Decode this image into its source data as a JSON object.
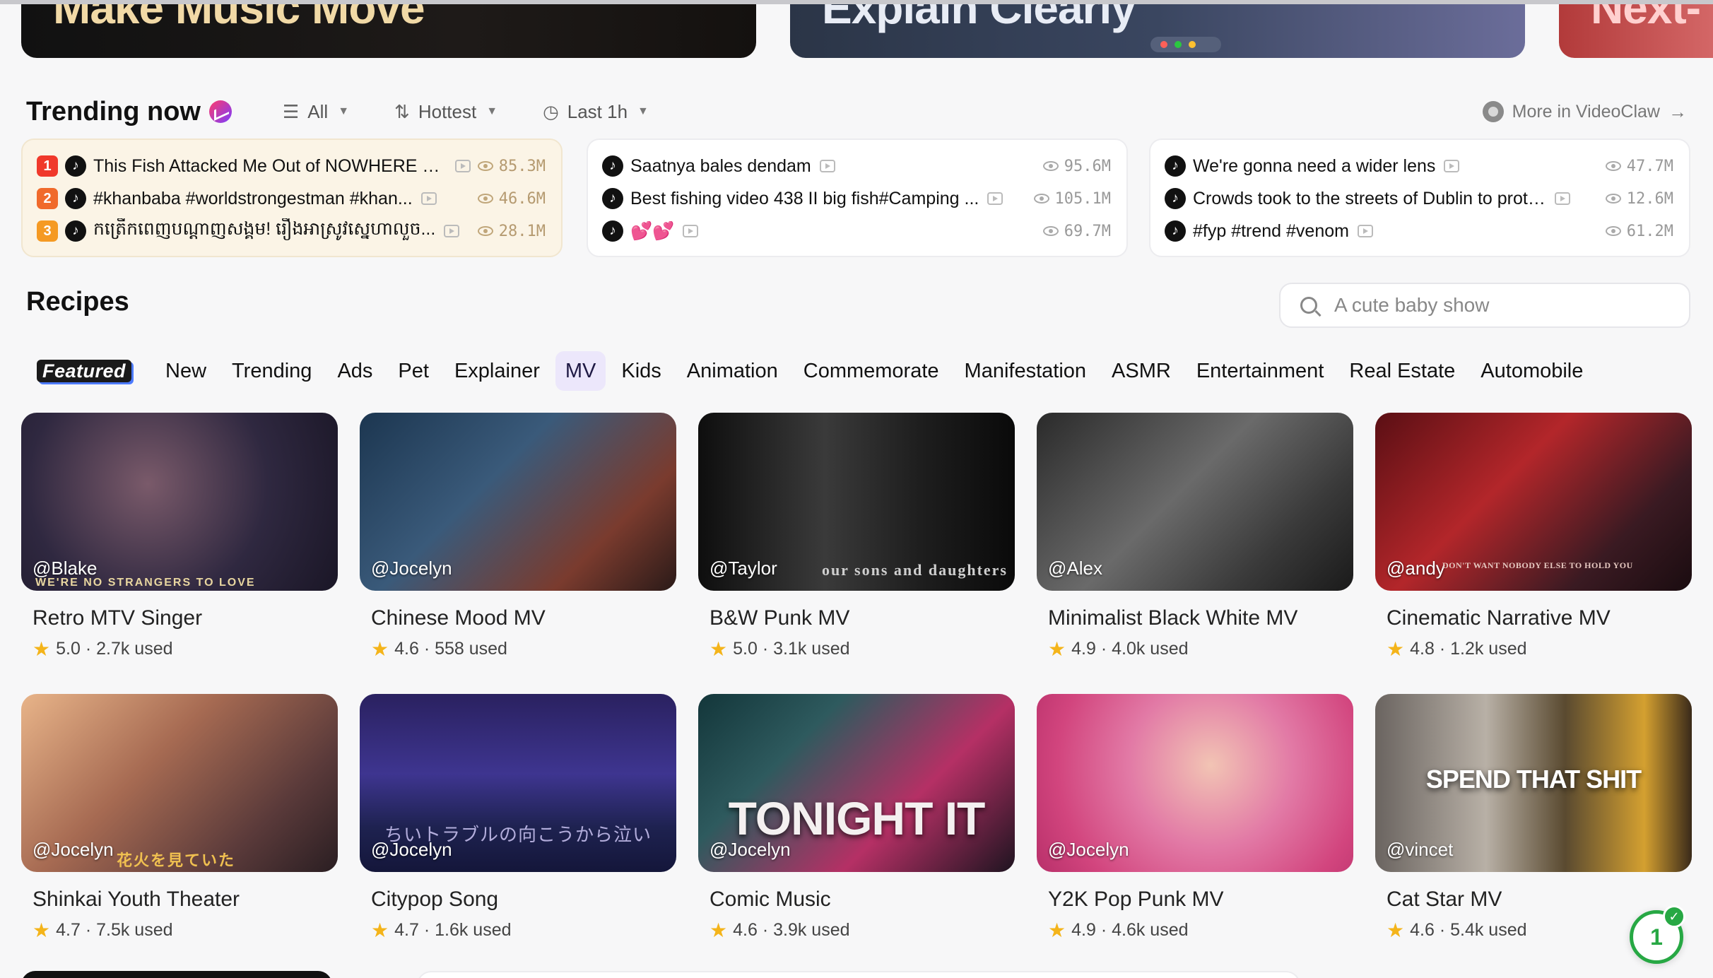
{
  "banners": [
    {
      "text": "Make Music Move"
    },
    {
      "text": "Explain Clearly"
    },
    {
      "text": "Next-"
    }
  ],
  "trending": {
    "title": "Trending now",
    "filters": [
      {
        "label": "All",
        "icon": "filter-icon"
      },
      {
        "label": "Hottest",
        "icon": "sort-icon"
      },
      {
        "label": "Last 1h",
        "icon": "clock-icon"
      }
    ],
    "more_link": "More in VideoClaw",
    "columns": [
      {
        "items": [
          {
            "rank": "1",
            "text": "This Fish Attacked Me Out of NOWHERE 😂...",
            "views": "85.3M"
          },
          {
            "rank": "2",
            "text": "#khanbaba #worldstrongestman #khan...",
            "views": "46.6M"
          },
          {
            "rank": "3",
            "text": "កត្រើកពេញបណ្ដាញសង្គម! រឿងអាស្រូវស្នេហាលួច...",
            "views": "28.1M"
          }
        ]
      },
      {
        "items": [
          {
            "text": "Saatnya bales dendam",
            "views": "95.6M"
          },
          {
            "text": "Best fishing video 438 II big fish#Camping ...",
            "views": "105.1M"
          },
          {
            "text": "💕💕",
            "views": "69.7M"
          }
        ]
      },
      {
        "items": [
          {
            "text": "We're gonna need a wider lens",
            "views": "47.7M"
          },
          {
            "text": "Crowds took to the streets of Dublin to protes...",
            "views": "12.6M"
          },
          {
            "text": "#fyp #trend #venom",
            "views": "61.2M"
          }
        ]
      }
    ]
  },
  "recipes": {
    "title": "Recipes",
    "search_placeholder": "A cute baby show",
    "tabs": [
      "Featured",
      "New",
      "Trending",
      "Ads",
      "Pet",
      "Explainer",
      "MV",
      "Kids",
      "Animation",
      "Commemorate",
      "Manifestation",
      "ASMR",
      "Entertainment",
      "Real Estate",
      "Automobile"
    ],
    "active_tab": "MV",
    "cards": [
      {
        "title": "Retro MTV Singer",
        "handle": "@Blake",
        "rating": "5.0",
        "used": "2.7k used",
        "overlay": "WE'RE NO STRANGERS TO LOVE"
      },
      {
        "title": "Chinese Mood MV",
        "handle": "@Jocelyn",
        "rating": "4.6",
        "used": "558 used",
        "overlay": ""
      },
      {
        "title": "B&W Punk MV",
        "handle": "@Taylor",
        "rating": "5.0",
        "used": "3.1k used",
        "overlay": "our sons and daughters"
      },
      {
        "title": "Minimalist Black White MV",
        "handle": "@Alex",
        "rating": "4.9",
        "used": "4.0k used",
        "overlay": ""
      },
      {
        "title": "Cinematic Narrative MV",
        "handle": "@andy",
        "rating": "4.8",
        "used": "1.2k used",
        "overlay": "DON'T WANT NOBODY ELSE TO HOLD YOU"
      },
      {
        "title": "Shinkai Youth Theater",
        "handle": "@Jocelyn",
        "rating": "4.7",
        "used": "7.5k used",
        "overlay": "花火を見ていた"
      },
      {
        "title": "Citypop Song",
        "handle": "@Jocelyn",
        "rating": "4.7",
        "used": "1.6k used",
        "overlay": "ちいトラブルの向こうから泣い"
      },
      {
        "title": "Comic Music",
        "handle": "@Jocelyn",
        "rating": "4.6",
        "used": "3.9k used",
        "overlay": "TONIGHT IT"
      },
      {
        "title": "Y2K Pop Punk MV",
        "handle": "@Jocelyn",
        "rating": "4.9",
        "used": "4.6k used",
        "overlay": ""
      },
      {
        "title": "Cat Star MV",
        "handle": "@vincet",
        "rating": "4.6",
        "used": "5.4k used",
        "overlay": "SPEND THAT SHIT"
      }
    ]
  },
  "notification_badge": "1",
  "colors": {
    "accent_tab_bg": "#ece7fb",
    "star": "#f4b41a",
    "rank1": "#f0392b",
    "rank2": "#f06a2b",
    "rank3": "#f59a23",
    "badge": "#27a844"
  }
}
